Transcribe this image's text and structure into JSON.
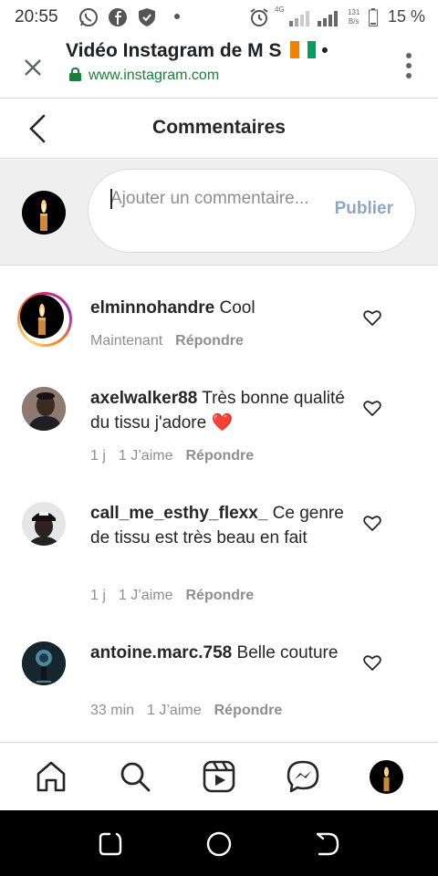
{
  "status": {
    "time": "20:55",
    "battery": "15 %",
    "speed_value": "131",
    "speed_unit": "B/s",
    "network": "4G",
    "icons": [
      "whatsapp-icon",
      "facebook-icon",
      "shield-icon",
      "dot-icon",
      "alarm-icon",
      "signal-icon",
      "battery-icon"
    ]
  },
  "browser": {
    "title": "Vidéo Instagram de M S",
    "title_suffix": "•",
    "flag_colors": [
      "#F77F00",
      "#FFFFFF",
      "#009E60"
    ],
    "url": "www.instagram.com",
    "url_color": "#1a7f37"
  },
  "header": {
    "title": "Commentaires"
  },
  "composer": {
    "placeholder": "Ajouter un commentaire...",
    "publish_label": "Publier",
    "publish_color": "#8fa6c1"
  },
  "comments": [
    {
      "username": "elminnohandre",
      "text": "Cool",
      "time": "Maintenant",
      "likes": "",
      "reply_label": "Répondre",
      "avatar": "candle-story"
    },
    {
      "username": "axelwalker88",
      "text": "Très bonne qualité du tissu j'adore ❤️",
      "time": "1 j",
      "likes": "1 J’aime",
      "reply_label": "Répondre",
      "avatar": "photo-man"
    },
    {
      "username": "call_me_esthy_flexx_",
      "text": "Ce genre de tissu est très beau en fait",
      "time": "1 j",
      "likes": "1 J’aime",
      "reply_label": "Répondre",
      "avatar": "photo-cap"
    },
    {
      "username": "antoine.marc.758",
      "text": "Belle couture",
      "time": "33 min",
      "likes": "1 J’aime",
      "reply_label": "Répondre",
      "avatar": "photo-dark"
    }
  ],
  "bottom_nav": [
    "home-icon",
    "search-icon",
    "reels-icon",
    "messenger-icon",
    "profile-avatar"
  ],
  "system_nav": [
    "recents-icon",
    "home-circle-icon",
    "back-icon"
  ]
}
